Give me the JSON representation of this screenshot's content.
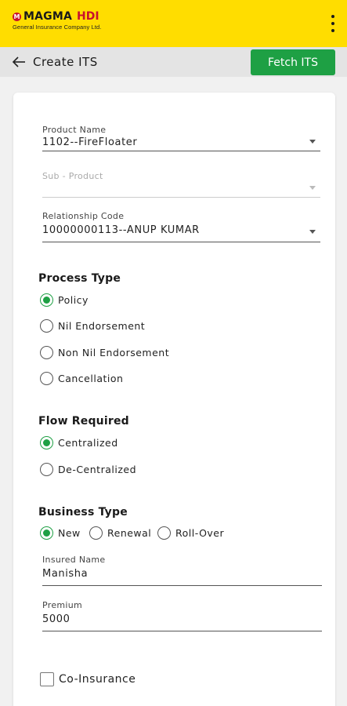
{
  "header": {
    "brand_left": "MAGMA",
    "brand_right": "HDI",
    "brand_mark": "M",
    "brand_sub": "General Insurance Company Ltd.",
    "menu_icon": "kebab-menu-icon",
    "brand_color": "#ffdd00"
  },
  "subbar": {
    "title": "Create ITS",
    "back_icon": "arrow-left-icon",
    "fetch_label": "Fetch ITS",
    "accent": "#1ea044"
  },
  "form": {
    "product_name": {
      "label": "Product Name",
      "value": "1102--FireFloater"
    },
    "sub_product": {
      "label": "Sub - Product",
      "value": ""
    },
    "relationship_code": {
      "label": "Relationship Code",
      "value": "10000000113--ANUP KUMAR"
    },
    "process_type": {
      "title": "Process Type",
      "options": [
        "Policy",
        "Nil Endorsement",
        "Non Nil Endorsement",
        "Cancellation"
      ],
      "selected": "Policy"
    },
    "flow_required": {
      "title": "Flow Required",
      "options": [
        "Centralized",
        "De-Centralized"
      ],
      "selected": "Centralized"
    },
    "business_type": {
      "title": "Business Type",
      "options": [
        "New",
        "Renewal",
        "Roll-Over"
      ],
      "selected": "New"
    },
    "insured_name": {
      "label": "Insured Name",
      "value": "Manisha"
    },
    "premium": {
      "label": "Premium",
      "value": "5000"
    },
    "co_insurance": {
      "label": "Co-Insurance",
      "checked": false
    }
  }
}
